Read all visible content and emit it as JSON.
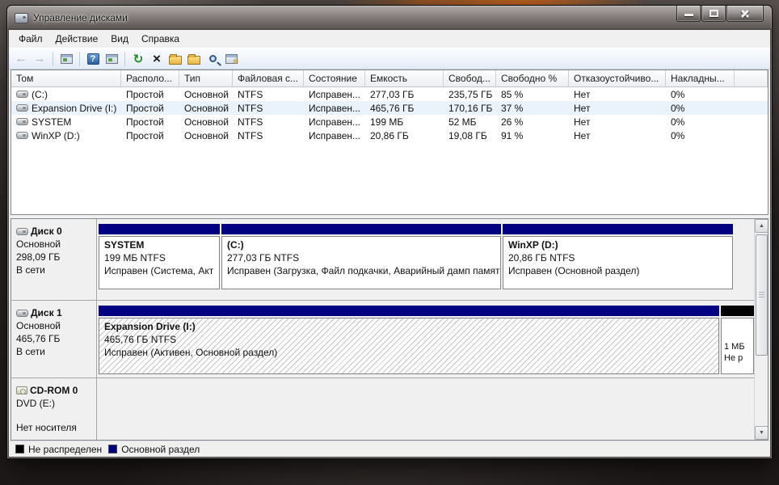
{
  "window": {
    "title": "Управление дисками"
  },
  "menu": {
    "items": [
      "Файл",
      "Действие",
      "Вид",
      "Справка"
    ]
  },
  "toolbar": {
    "icons": [
      "back-icon",
      "forward-icon",
      "console-window-icon",
      "help-icon",
      "console-tree-icon",
      "refresh-icon",
      "delete-icon",
      "properties-icon",
      "open-folder-icon",
      "zoom-icon",
      "settings-icon"
    ]
  },
  "volumes": {
    "headers": [
      "Том",
      "Располо...",
      "Тип",
      "Файловая с...",
      "Состояние",
      "Емкость",
      "Свобод...",
      "Свободно %",
      "Отказоустойчиво...",
      "Накладны..."
    ],
    "rows": [
      {
        "cells": [
          "(C:)",
          "Простой",
          "Основной",
          "NTFS",
          "Исправен...",
          "277,03 ГБ",
          "235,75 ГБ",
          "85 %",
          "Нет",
          "0%"
        ]
      },
      {
        "cells": [
          "Expansion Drive (I:)",
          "Простой",
          "Основной",
          "NTFS",
          "Исправен...",
          "465,76 ГБ",
          "170,16 ГБ",
          "37 %",
          "Нет",
          "0%"
        ]
      },
      {
        "cells": [
          "SYSTEM",
          "Простой",
          "Основной",
          "NTFS",
          "Исправен...",
          "199 МБ",
          "52 МБ",
          "26 %",
          "Нет",
          "0%"
        ]
      },
      {
        "cells": [
          "WinXP (D:)",
          "Простой",
          "Основной",
          "NTFS",
          "Исправен...",
          "20,86 ГБ",
          "19,08 ГБ",
          "91 %",
          "Нет",
          "0%"
        ]
      }
    ]
  },
  "disks": [
    {
      "name": "Диск 0",
      "type": "Основной",
      "size": "298,09 ГБ",
      "status": "В сети",
      "partitions": [
        {
          "name": "SYSTEM",
          "size_line": "199 МБ NTFS",
          "status_line": "Исправен (Система, Акт"
        },
        {
          "name": "(C:)",
          "size_line": "277,03 ГБ NTFS",
          "status_line": "Исправен (Загрузка, Файл подкачки, Аварийный дамп памят"
        },
        {
          "name": "WinXP  (D:)",
          "size_line": "20,86 ГБ NTFS",
          "status_line": "Исправен (Основной раздел)"
        }
      ]
    },
    {
      "name": "Диск 1",
      "type": "Основной",
      "size": "465,76 ГБ",
      "status": "В сети",
      "partitions": [
        {
          "name": "Expansion Drive  (I:)",
          "size_line": "465,76 ГБ NTFS",
          "status_line": "Исправен (Активен, Основной раздел)"
        }
      ],
      "unallocated": {
        "size": "1 МБ",
        "label": "Не р"
      }
    },
    {
      "name": "CD-ROM 0",
      "type": "DVD (E:)",
      "status": "Нет носителя"
    }
  ],
  "legend": {
    "items": [
      {
        "label": "Не распределен",
        "color": "#000000"
      },
      {
        "label": "Основной раздел",
        "color": "#000080"
      }
    ]
  },
  "colors": {
    "primary_partition": "#000080",
    "unallocated": "#000000"
  }
}
